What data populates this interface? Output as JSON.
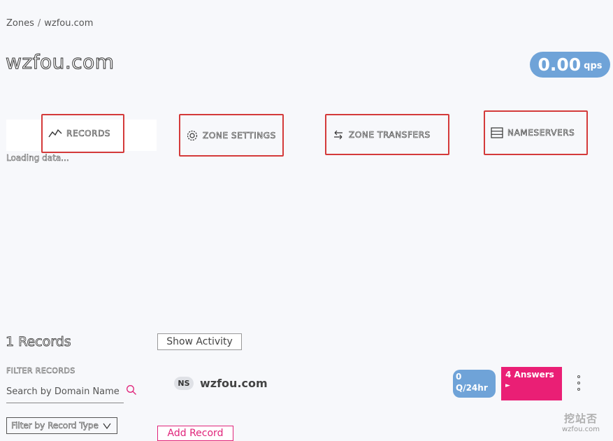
{
  "breadcrumb": {
    "root": "Zones",
    "separator": "/",
    "current": "wzfou.com"
  },
  "zone": {
    "title": "wzfou.com"
  },
  "qps": {
    "value": "0.00",
    "unit": "qps"
  },
  "tabs": [
    {
      "label": "RECORDS",
      "icon": "activity-chart-icon"
    },
    {
      "label": "ZONE SETTINGS",
      "icon": "gear-icon"
    },
    {
      "label": "ZONE TRANSFERS",
      "icon": "transfer-arrows-icon"
    },
    {
      "label": "NAMESERVERS",
      "icon": "server-list-icon"
    }
  ],
  "status": {
    "loading": "Loading data..."
  },
  "records": {
    "count_label": "1 Records",
    "show_activity": "Show Activity",
    "filter_label": "FILTER RECORDS",
    "search_placeholder": "Search by Domain Name",
    "filter_type_label": "Filter by Record Type",
    "add_record": "Add Record",
    "rows": [
      {
        "type": "NS",
        "name": "wzfou.com",
        "queries": "0 Q/24hr",
        "answers": "4 Answers",
        "answers_arrow": "►"
      }
    ]
  },
  "watermark": {
    "line1": "挖站否",
    "line2": "wzfou.com"
  },
  "colors": {
    "accent_blue": "#6fa3d8",
    "accent_pink": "#ea1f75",
    "highlight_red": "#d43a3a"
  }
}
